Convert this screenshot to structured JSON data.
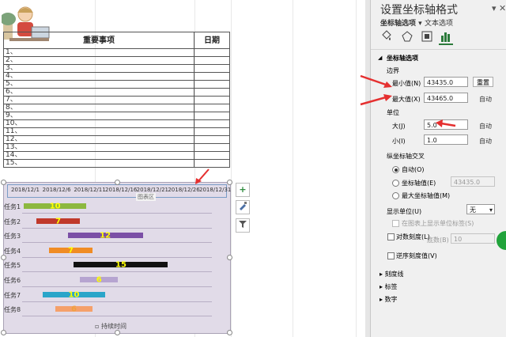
{
  "sheet": {
    "header": {
      "item": "重要事项",
      "date": "日期"
    },
    "rows": [
      "1、",
      "2、",
      "3、",
      "4、",
      "5、",
      "6、",
      "7、",
      "8、",
      "9、",
      "10、",
      "11、",
      "12、",
      "13、",
      "14、",
      "15、"
    ]
  },
  "chart_data": {
    "type": "bar",
    "orientation": "horizontal-gantt",
    "x_ticks": [
      "2018/12/1",
      "2018/12/6",
      "2018/12/11",
      "2018/12/16",
      "2018/12/21",
      "2018/12/26",
      "2018/12/31"
    ],
    "x_axis_label": "图表区",
    "xlim": [
      43435,
      43465
    ],
    "categories": [
      "任务1",
      "任务2",
      "任务3",
      "任务4",
      "任务5",
      "任务6",
      "任务7",
      "任务8"
    ],
    "series": [
      {
        "name": "持续时间",
        "values": [
          10,
          7,
          12,
          7,
          15,
          6,
          10,
          6
        ]
      }
    ],
    "legend": "持续时间",
    "legend_position": "bottom"
  },
  "chart_tools": {
    "add_element": "+",
    "style": "brush",
    "filter": "filter"
  },
  "pane": {
    "title": "设置坐标轴格式",
    "tab_axis": "坐标轴选项",
    "tab_text": "文本选项",
    "section_axis_options": "坐标轴选项",
    "bounds_label": "边界",
    "min_label": "最小值(N)",
    "min_value": "43435.0",
    "reset": "重置",
    "max_label": "最大值(X)",
    "max_value": "43465.0",
    "auto": "自动",
    "units_label": "单位",
    "major_label": "大(J)",
    "major_value": "5.0",
    "minor_label": "小(I)",
    "minor_value": "1.0",
    "cross_label": "纵坐标轴交叉",
    "cross_auto": "自动(O)",
    "cross_value_label": "坐标轴值(E)",
    "cross_value": "43435.0",
    "cross_max": "最大坐标轴值(M)",
    "display_units_label": "显示单位(U)",
    "display_units_value": "无",
    "show_units_label": "在图表上显示单位标签(S)",
    "log_label": "对数刻度(L)",
    "base_label": "底数(B)",
    "base_value": "10",
    "reverse_label": "逆序刻度值(V)",
    "tick_marks": "刻度线",
    "labels": "标签",
    "number": "数字"
  }
}
